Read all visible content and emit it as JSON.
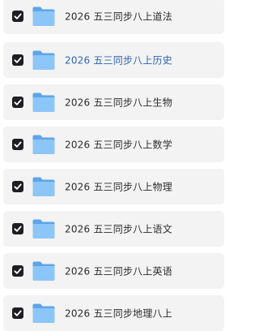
{
  "icons": {
    "checkbox": "checkbox-checked-icon",
    "folder": "folder-icon"
  },
  "colors": {
    "row_background": "#f3f3f3",
    "checkbox_fill": "#1e1f22",
    "folder_blue": "#6fb2f2",
    "label_text": "#2c2c2c",
    "label_highlight": "#2e64b0"
  },
  "folders": [
    {
      "name": "2026 五三同步八上道法",
      "checked": true,
      "highlighted": false
    },
    {
      "name": "2026 五三同步八上历史",
      "checked": true,
      "highlighted": true
    },
    {
      "name": "2026 五三同步八上生物",
      "checked": true,
      "highlighted": false
    },
    {
      "name": "2026 五三同步八上数学",
      "checked": true,
      "highlighted": false
    },
    {
      "name": "2026 五三同步八上物理",
      "checked": true,
      "highlighted": false
    },
    {
      "name": "2026 五三同步八上语文",
      "checked": true,
      "highlighted": false
    },
    {
      "name": "2026 五三同步八上英语",
      "checked": true,
      "highlighted": false
    },
    {
      "name": "2026 五三同步地理八上",
      "checked": true,
      "highlighted": false
    }
  ]
}
